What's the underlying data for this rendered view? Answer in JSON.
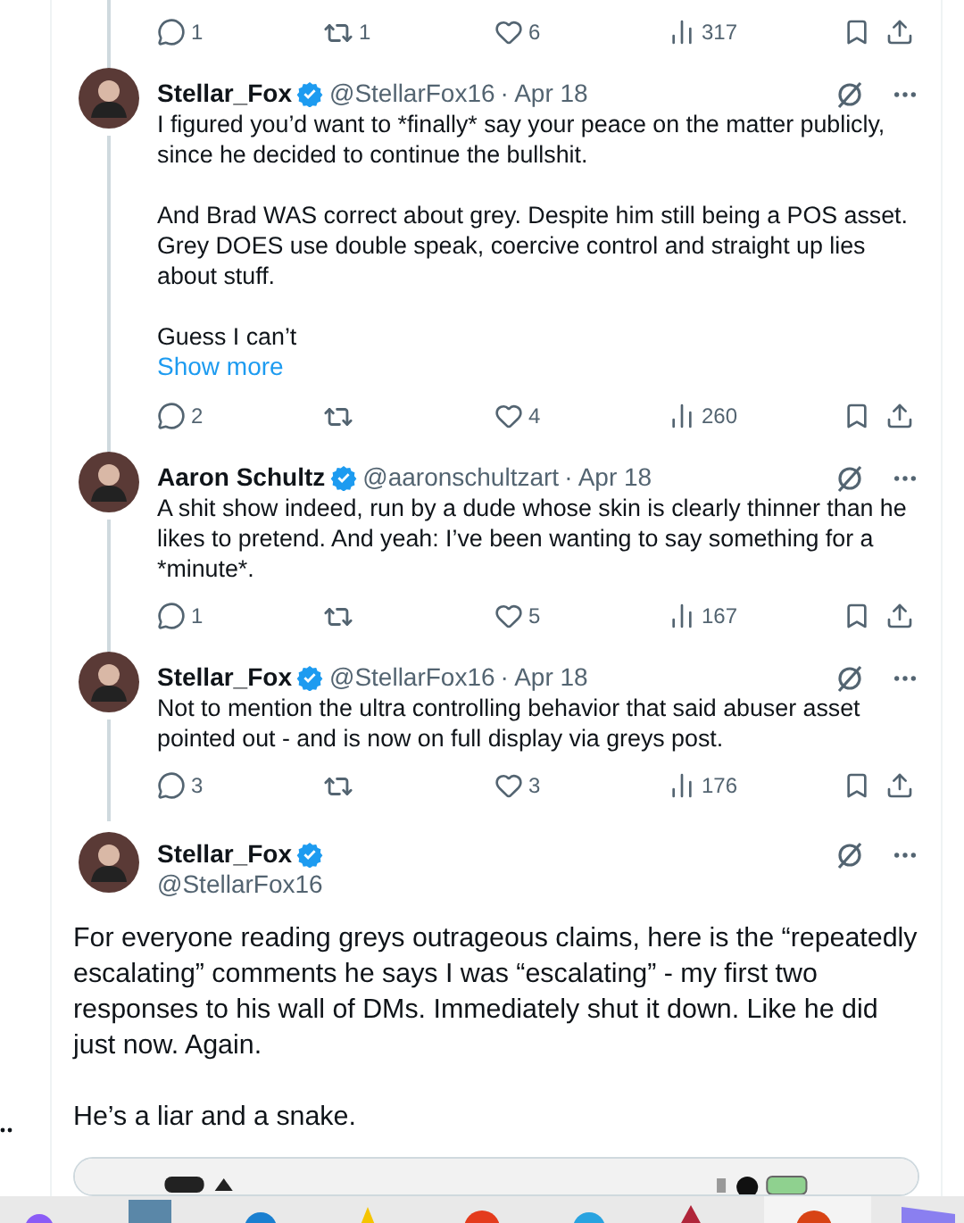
{
  "previous_reply_actions": {
    "replies": "1",
    "reposts": "1",
    "likes": "6",
    "views": "317"
  },
  "replies": [
    {
      "name": "Stellar_Fox",
      "handle": "@StellarFox16",
      "date": "· Apr 18",
      "paragraphs": [
        "I figured you’d want to *finally* say your peace on the matter publicly, since he decided to continue the bullshit.",
        "And Brad WAS correct about grey. Despite him still being a POS asset. Grey DOES use double speak, coercive control and straight up lies about stuff.",
        "Guess I can’t"
      ],
      "show_more": "Show more",
      "actions": {
        "replies": "2",
        "likes": "4",
        "views": "260"
      }
    },
    {
      "name": "Aaron Schultz",
      "handle": "@aaronschultzart",
      "date": "· Apr 18",
      "paragraphs": [
        "A shit show indeed, run by a dude whose skin is clearly thinner than he likes to pretend. And yeah: I’ve been wanting to say something for a *minute*."
      ],
      "actions": {
        "replies": "1",
        "likes": "5",
        "views": "167"
      }
    },
    {
      "name": "Stellar_Fox",
      "handle": "@StellarFox16",
      "date": "· Apr 18",
      "paragraphs": [
        "Not to mention the ultra controlling behavior that said abuser asset pointed out - and is now on full display via greys post."
      ],
      "actions": {
        "replies": "3",
        "likes": "3",
        "views": "176"
      }
    }
  ],
  "main_post": {
    "name": "Stellar_Fox",
    "handle": "@StellarFox16",
    "paragraphs": [
      "For everyone reading greys outrageous claims, here is the “repeatedly escalating” comments he says I was “escalating” - my first two responses to his wall of DMs. Immediately shut it down. Like he did just now. Again.",
      "He’s a liar and a snake."
    ]
  }
}
